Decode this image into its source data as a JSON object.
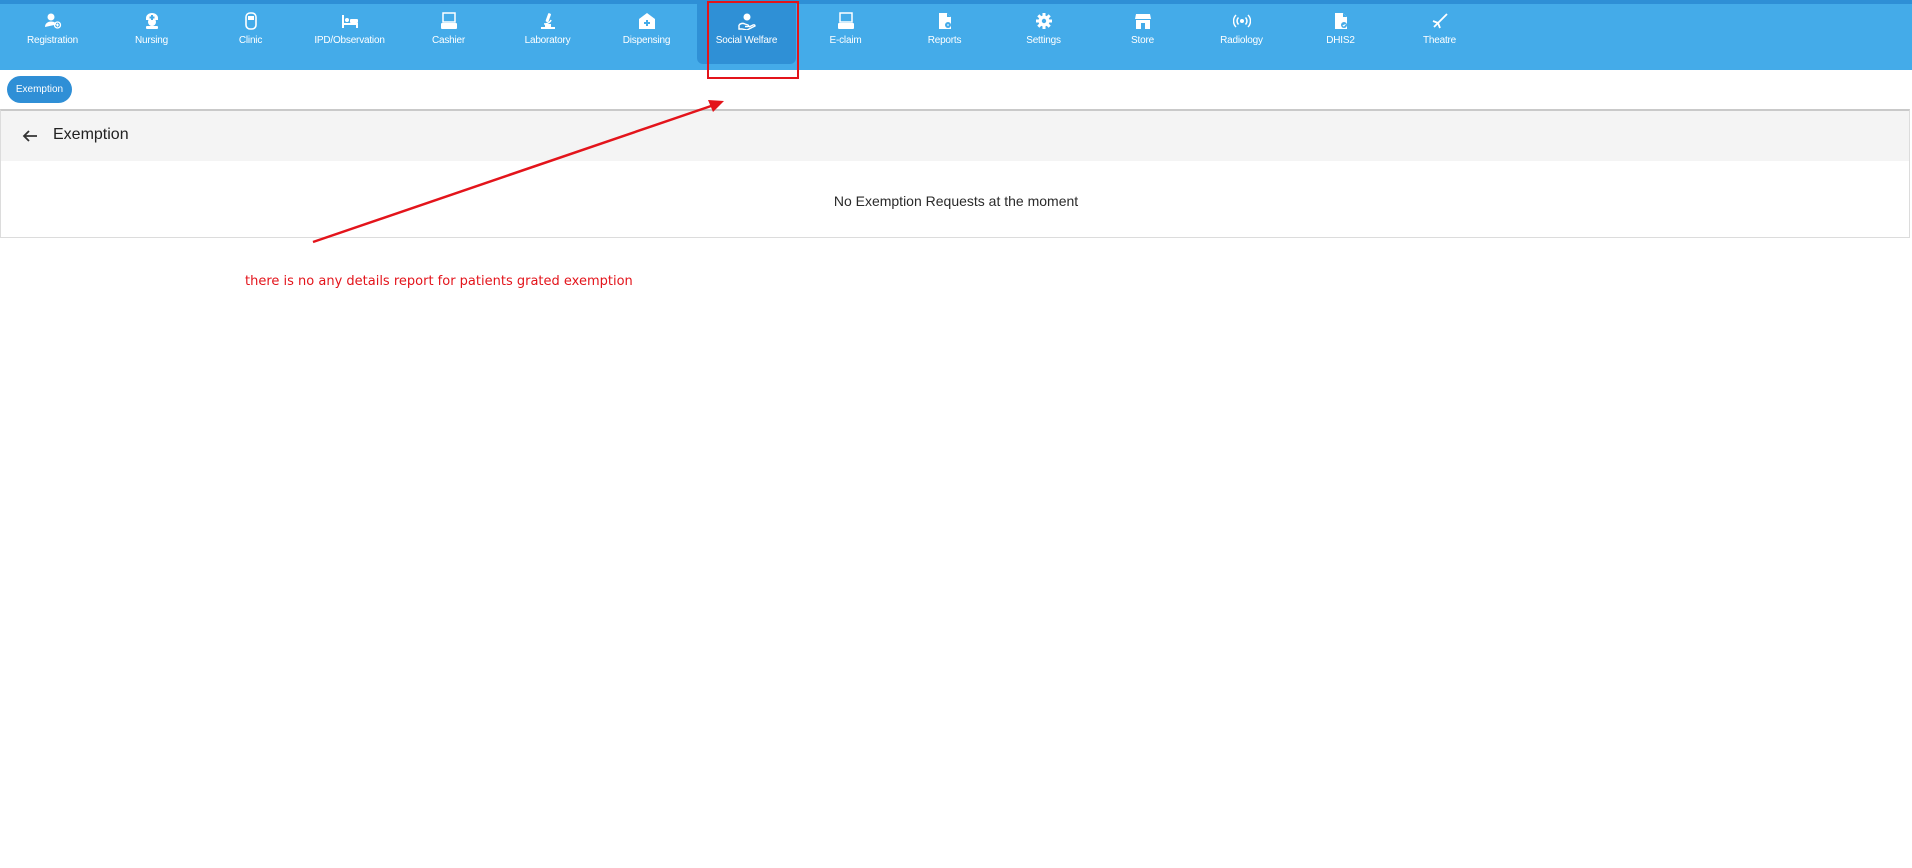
{
  "nav": {
    "items": [
      {
        "label": "Registration",
        "icon": "registration-icon"
      },
      {
        "label": "Nursing",
        "icon": "nursing-icon"
      },
      {
        "label": "Clinic",
        "icon": "clinic-icon"
      },
      {
        "label": "IPD/Observation",
        "icon": "bed-icon"
      },
      {
        "label": "Cashier",
        "icon": "cashier-icon"
      },
      {
        "label": "Laboratory",
        "icon": "microscope-icon"
      },
      {
        "label": "Dispensing",
        "icon": "dispensing-icon"
      },
      {
        "label": "Social Welfare",
        "icon": "social-welfare-icon",
        "active": true
      },
      {
        "label": "E-claim",
        "icon": "eclaim-icon"
      },
      {
        "label": "Reports",
        "icon": "reports-icon"
      },
      {
        "label": "Settings",
        "icon": "gear-icon"
      },
      {
        "label": "Store",
        "icon": "store-icon"
      },
      {
        "label": "Radiology",
        "icon": "radiology-icon"
      },
      {
        "label": "DHIS2",
        "icon": "dhis2-icon"
      },
      {
        "label": "Theatre",
        "icon": "theatre-icon"
      }
    ]
  },
  "subnav": {
    "chip_label": "Exemption"
  },
  "panel": {
    "title": "Exemption",
    "empty_message": "No Exemption Requests at the moment"
  },
  "annotation": {
    "text": "there is no any details report for patients grated exemption"
  },
  "colors": {
    "navbar": "#44abe9",
    "active_tab": "#2f90d6",
    "annotation_red": "#e3141b"
  }
}
